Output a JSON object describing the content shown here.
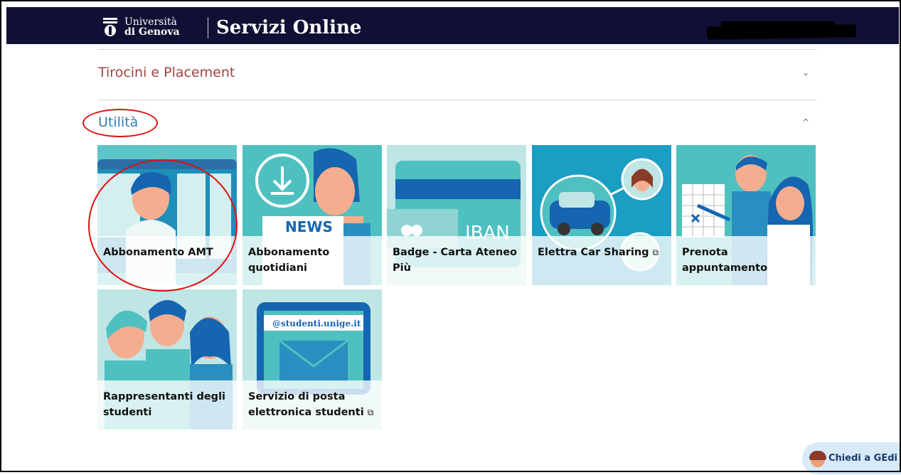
{
  "header": {
    "university_line1": "Università",
    "university_line2": "di Genova",
    "title": "Servizi Online"
  },
  "sections": {
    "tirocini": {
      "label": "Tirocini e Placement",
      "chevron": "⌄"
    },
    "utilita": {
      "label": "Utilità",
      "chevron": "^"
    }
  },
  "tiles": {
    "amt": {
      "label": "Abbonamento AMT"
    },
    "quotidiani": {
      "label": "Abbonamento quotidiani",
      "art_text": "NEWS"
    },
    "badge": {
      "label": "Badge - Carta Ateneo Più",
      "art_text": "IBAN"
    },
    "car": {
      "label": "Elettra Car Sharing",
      "ext_icon": "⧉"
    },
    "prenota": {
      "label": "Prenota appuntamento"
    },
    "rappresentanti": {
      "label": "Rappresentanti degli studenti"
    },
    "posta": {
      "label": "Servizio di posta elettronica studenti",
      "art_text": "@studenti.unige.it",
      "ext_icon": "⧉"
    }
  },
  "help": {
    "label": "Chiedi a GEdi"
  },
  "colors": {
    "header_bg": "#101035",
    "tile_teal": "#4fc0c0",
    "accent_blue": "#2f7fb5",
    "annotation_red": "#e01010"
  }
}
